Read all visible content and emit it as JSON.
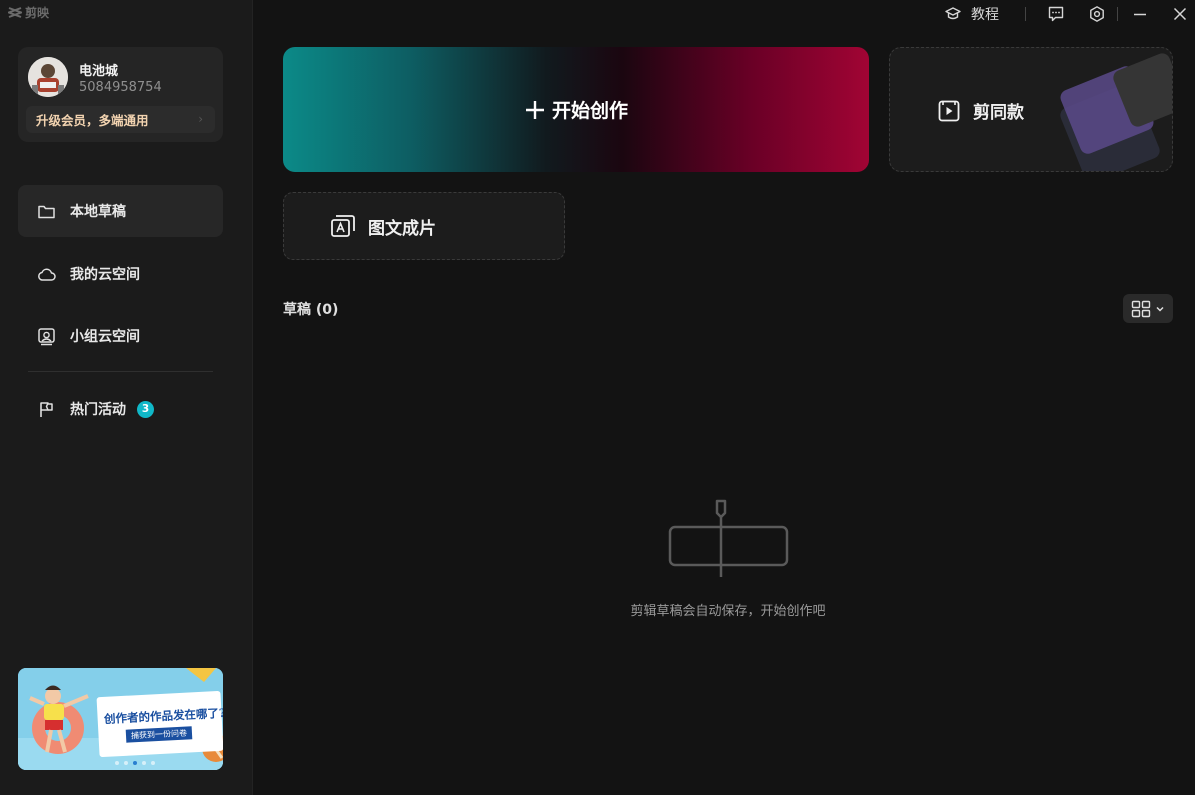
{
  "app": {
    "logo_text": "剪映"
  },
  "user": {
    "name": "电池城",
    "id": "5084958754",
    "vip_prompt": "升级会员，多端通用"
  },
  "nav": [
    {
      "label": "本地草稿",
      "icon": "folder-icon",
      "active": true
    },
    {
      "label": "我的云空间",
      "icon": "cloud-icon",
      "active": false
    },
    {
      "label": "小组云空间",
      "icon": "team-cloud-icon",
      "active": false
    },
    {
      "label": "热门活动",
      "icon": "flag-icon",
      "active": false,
      "badge": "3"
    }
  ],
  "promo": {
    "title": "创作者的作品发在哪了?",
    "subtitle": "捕获到一份问卷"
  },
  "titlebar": {
    "tutorial_label": "教程",
    "icons": [
      "graduation-cap-icon",
      "feedback-icon",
      "settings-icon",
      "minimize-icon",
      "close-icon"
    ]
  },
  "actions": {
    "start_label": "开始创作",
    "template_label": "剪同款",
    "image_text_label": "图文成片"
  },
  "drafts": {
    "title": "草稿",
    "count": "(0)",
    "empty_message": "剪辑草稿会自动保存，开始创作吧"
  },
  "colors": {
    "accent_teal": "#0c8a88",
    "accent_red": "#a10434",
    "badge": "#10b8c8",
    "vip_text": "#f2d3b0"
  }
}
